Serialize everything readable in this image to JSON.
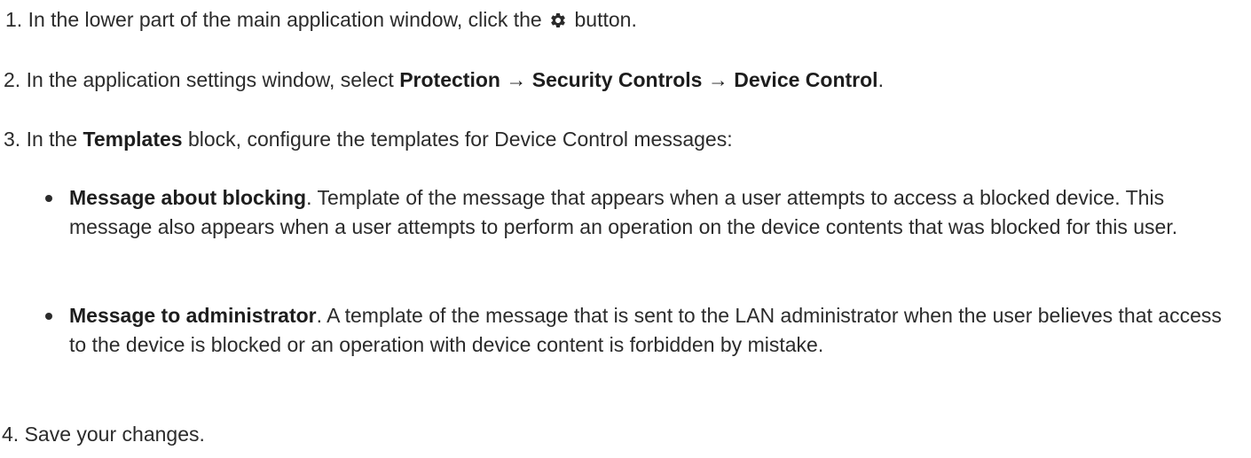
{
  "steps": {
    "s1": {
      "number": "1.",
      "before": "In the lower part of the main application window, click the",
      "icon": "gear-icon",
      "after": "button."
    },
    "s2": {
      "number": "2.",
      "before": "In the application settings window, select",
      "path1": "Protection",
      "arrow1": "→",
      "path2": "Security Controls",
      "arrow2": "→",
      "path3": "Device Control",
      "after": "."
    },
    "s3": {
      "number": "3.",
      "before": "In the",
      "bold": "Templates",
      "after": "block, configure the templates for Device Control messages:"
    },
    "s4": {
      "number": "4.",
      "text": "Save your changes."
    }
  },
  "bullets": [
    {
      "term": "Message about blocking",
      "description": ". Template of the message that appears when a user attempts to access a blocked device. This message also appears when a user attempts to perform an operation on the device contents that was blocked for this user."
    },
    {
      "term": "Message to administrator",
      "description": ". A template of the message that is sent to the LAN administrator when the user believes that access to the device is blocked or an operation with device content is forbidden by mistake."
    }
  ],
  "colors": {
    "text": "#2b2b2b",
    "background": "#ffffff"
  }
}
